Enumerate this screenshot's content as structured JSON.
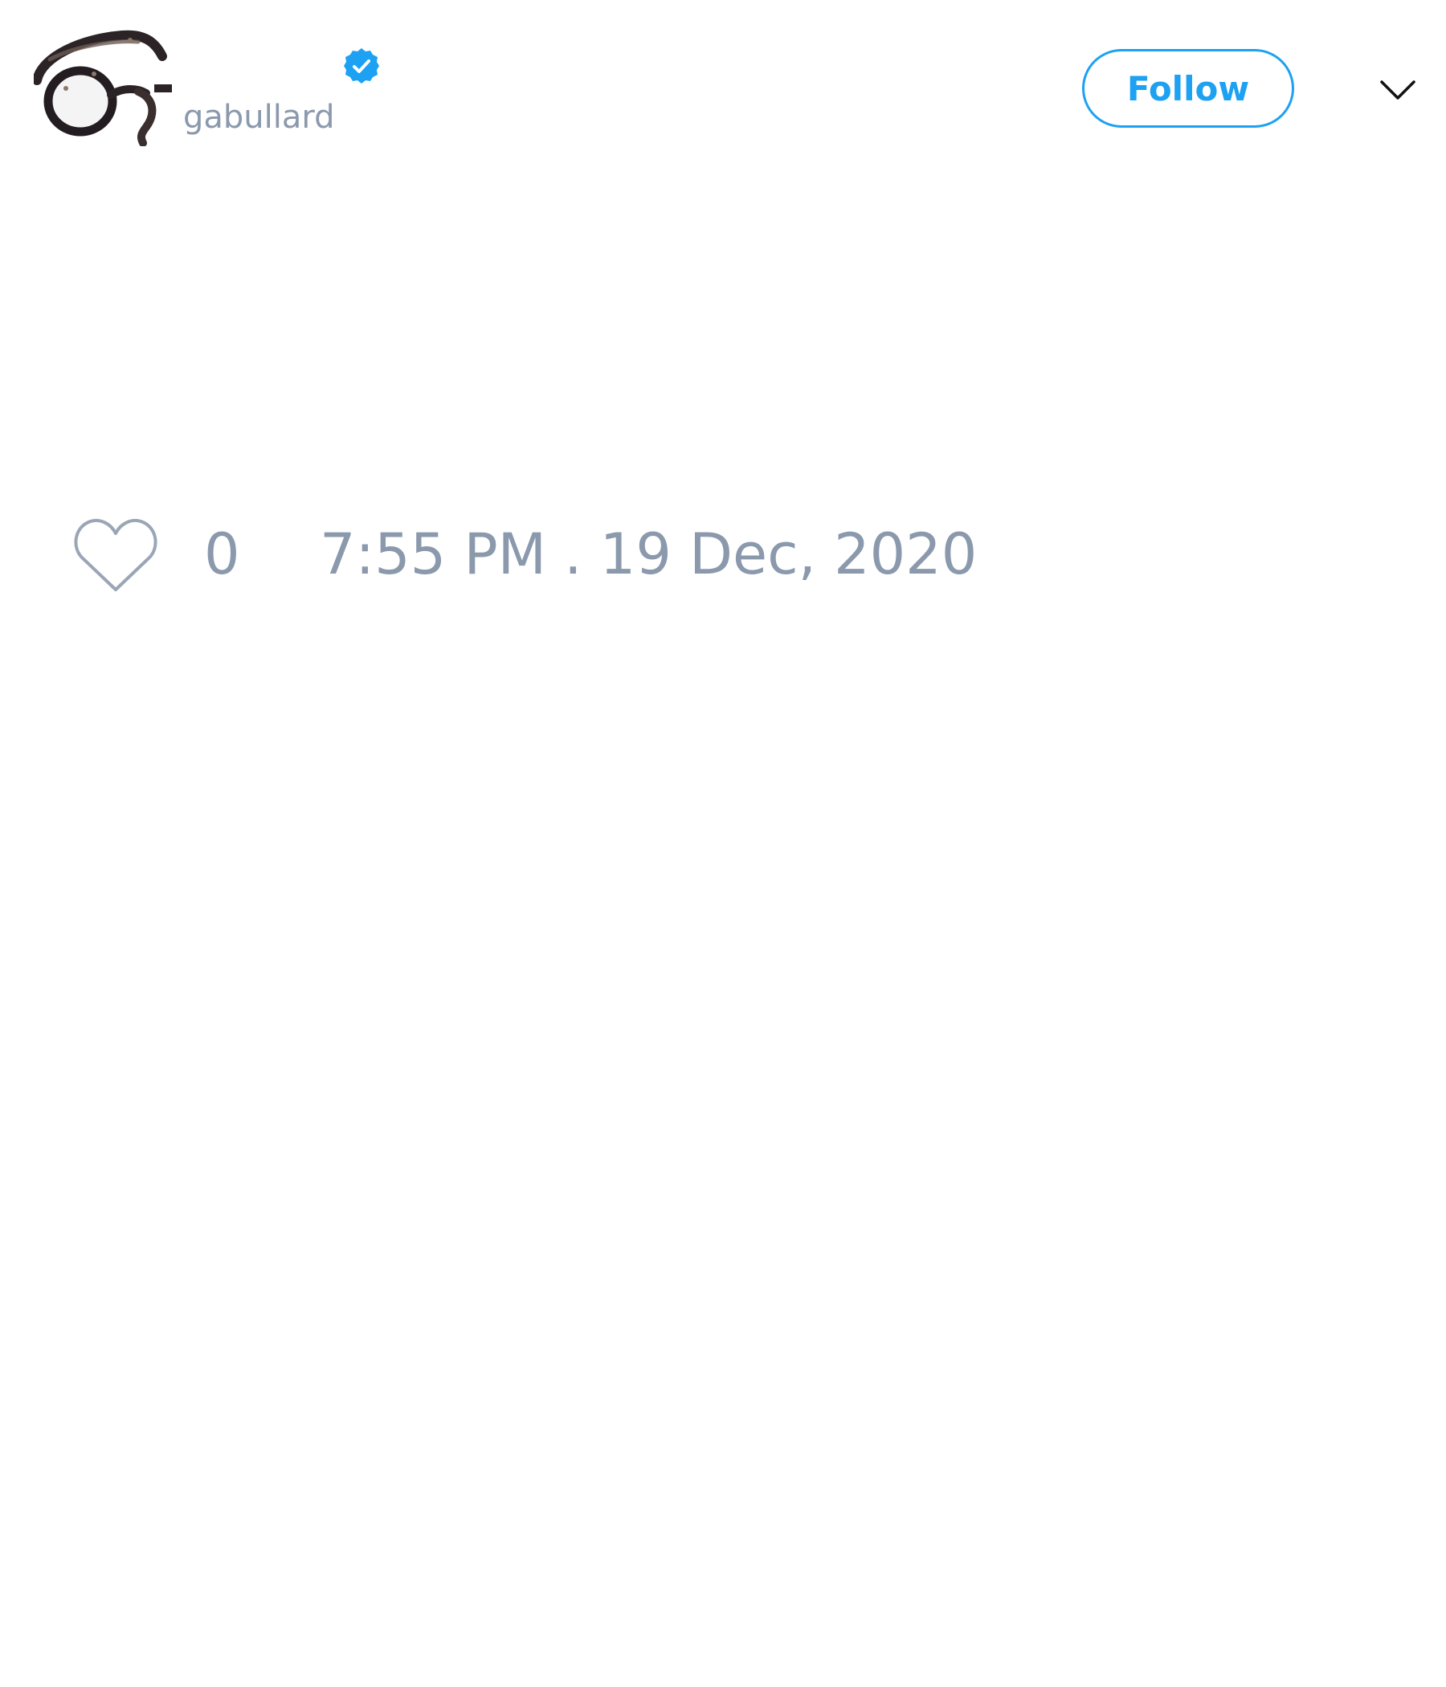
{
  "header": {
    "username": "gabullard",
    "verified_color": "#1da1f2",
    "follow_label": "Follow",
    "accent_color": "#1da1f2"
  },
  "icons": {
    "avatar": "glasses-avatar",
    "verified": "verified-badge-icon",
    "menu": "chevron-down-icon",
    "like": "heart-outline-icon"
  },
  "tweet": {
    "like_count": "0",
    "timestamp": "7:55 PM . 19 Dec, 2020"
  },
  "colors": {
    "muted_text": "#8b99ad",
    "background": "#ffffff"
  }
}
